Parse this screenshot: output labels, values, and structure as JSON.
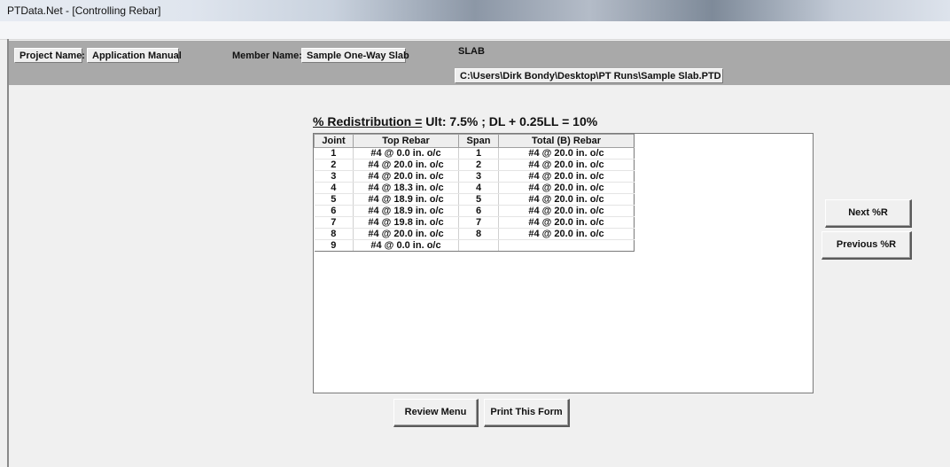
{
  "window": {
    "title": "PTData.Net - [Controlling Rebar]"
  },
  "header": {
    "project_label": "Project Name:",
    "project_value": "Application Manual",
    "member_label": "Member Name:",
    "member_value": "Sample One-Way Slab",
    "type_value": "SLAB",
    "file_path": "C:\\Users\\Dirk Bondy\\Desktop\\PT Runs\\Sample Slab.PTD"
  },
  "redistribution": {
    "label": "% Redistribution =",
    "value": "Ult: 7.5% ; DL + 0.25LL = 10%"
  },
  "table": {
    "columns": [
      "Joint",
      "Top Rebar",
      "Span",
      "Total (B) Rebar"
    ],
    "rows": [
      [
        "1",
        "#4 @ 0.0 in. o/c",
        "1",
        "#4 @ 20.0 in. o/c"
      ],
      [
        "2",
        "#4 @ 20.0 in. o/c",
        "2",
        "#4 @ 20.0 in. o/c"
      ],
      [
        "3",
        "#4 @ 20.0 in. o/c",
        "3",
        "#4 @ 20.0 in. o/c"
      ],
      [
        "4",
        "#4 @ 18.3 in. o/c",
        "4",
        "#4 @ 20.0 in. o/c"
      ],
      [
        "5",
        "#4 @ 18.9 in. o/c",
        "5",
        "#4 @ 20.0 in. o/c"
      ],
      [
        "6",
        "#4 @ 18.9 in. o/c",
        "6",
        "#4 @ 20.0 in. o/c"
      ],
      [
        "7",
        "#4 @ 19.8 in. o/c",
        "7",
        "#4 @ 20.0 in. o/c"
      ],
      [
        "8",
        "#4 @ 20.0 in. o/c",
        "8",
        "#4 @ 20.0 in. o/c"
      ],
      [
        "9",
        "#4 @ 0.0 in. o/c",
        "",
        ""
      ]
    ]
  },
  "buttons": {
    "next": "Next %R",
    "previous": "Previous %R",
    "review": "Review Menu",
    "print": "Print This Form"
  }
}
